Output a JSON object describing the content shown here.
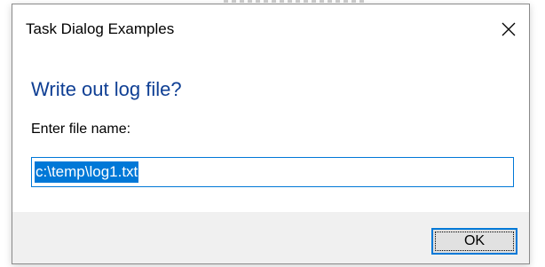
{
  "window": {
    "title": "Task Dialog Examples",
    "close_icon": "close-icon"
  },
  "dialog": {
    "main_instruction": "Write out log file?",
    "content": "Enter file name:",
    "input": {
      "value": "c:\\temp\\log1.txt",
      "selected": true
    },
    "ok_label": "OK"
  },
  "colors": {
    "instruction": "#0f3f94",
    "accent": "#0078d7",
    "footer_bg": "#f0f0f0"
  }
}
